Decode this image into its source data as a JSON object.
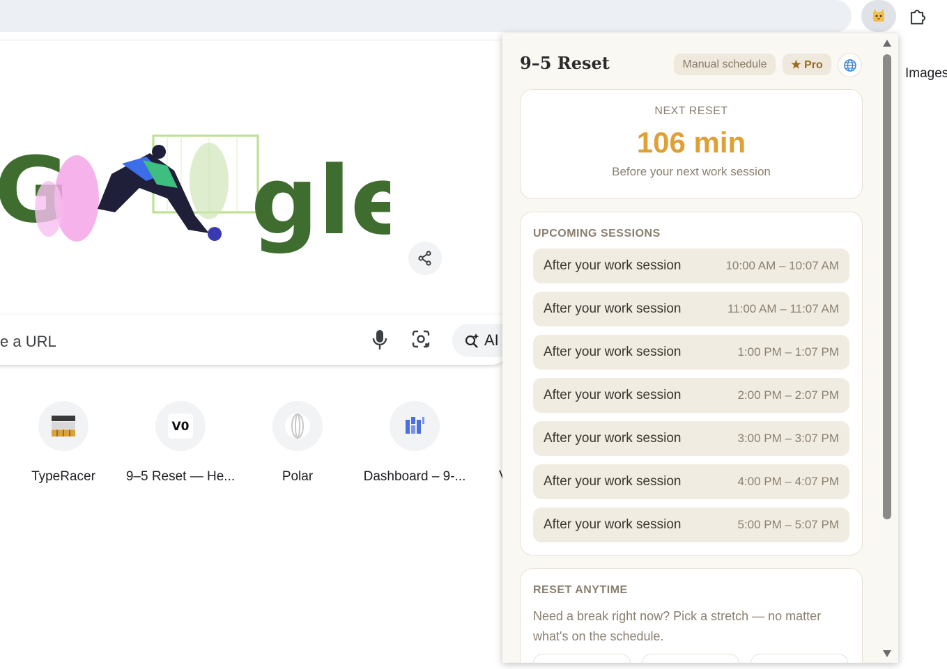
{
  "browser": {
    "extensions": [
      {
        "name": "9-5 reset extension",
        "icon": "cat-face-icon"
      },
      {
        "name": "extensions",
        "icon": "puzzle-icon"
      }
    ]
  },
  "google": {
    "images_link": "Images",
    "doodle_text": "gle",
    "search_placeholder": "e a URL",
    "ai_label": "AI",
    "shortcuts": [
      {
        "label": "TypeRacer",
        "icon": "typeracer-icon"
      },
      {
        "label": "9–5 Reset — He...",
        "icon": "v0-icon"
      },
      {
        "label": "Polar",
        "icon": "polar-icon"
      },
      {
        "label": "Dashboard – 9-...",
        "icon": "dashboard-icon"
      }
    ],
    "partial_shortcut_char": "V"
  },
  "popup": {
    "title": "9–5 Reset",
    "chip_manual": "Manual schedule",
    "chip_pro": "★ Pro",
    "next_reset": {
      "label": "NEXT RESET",
      "value": "106 min",
      "subtitle": "Before your next work session"
    },
    "upcoming": {
      "label": "UPCOMING SESSIONS",
      "sessions": [
        {
          "name": "After your work session",
          "time": "10:00 AM – 10:07 AM"
        },
        {
          "name": "After your work session",
          "time": "11:00 AM – 11:07 AM"
        },
        {
          "name": "After your work session",
          "time": "1:00 PM – 1:07 PM"
        },
        {
          "name": "After your work session",
          "time": "2:00 PM – 2:07 PM"
        },
        {
          "name": "After your work session",
          "time": "3:00 PM – 3:07 PM"
        },
        {
          "name": "After your work session",
          "time": "4:00 PM – 4:07 PM"
        },
        {
          "name": "After your work session",
          "time": "5:00 PM – 5:07 PM"
        }
      ]
    },
    "anytime": {
      "label": "RESET ANYTIME",
      "description": "Need a break right now? Pick a stretch — no matter what's on the schedule."
    }
  },
  "colors": {
    "accent": "#dfa035",
    "chip_bg": "#efe9dd",
    "session_bg": "#f1ece1",
    "popup_bg": "#faf8f3"
  }
}
